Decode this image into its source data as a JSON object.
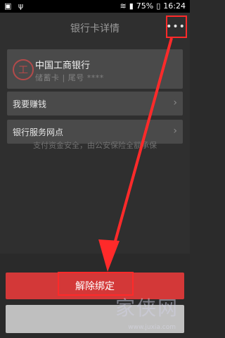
{
  "status": {
    "battery_pct": "75%",
    "time": "16:24"
  },
  "title_bar": {
    "title": "银行卡详情",
    "more": "•••"
  },
  "bank": {
    "name": "中国工商银行",
    "subtitle": "储蓄卡 | 尾号 ****"
  },
  "menu": [
    {
      "label": "我要赚钱"
    },
    {
      "label": "银行服务网点"
    }
  ],
  "security_note": "支付资金安全，由公安保险全额承保",
  "buttons": {
    "unbind": "解除绑定",
    "secondary": ""
  },
  "watermark": {
    "cn": "家侠网",
    "url": "www.juxia.com"
  },
  "colors": {
    "accent": "#d33838",
    "annotation": "#ff2a2a"
  },
  "icons": [
    "image-icon",
    "usb-icon",
    "wifi-icon",
    "signal-icon",
    "battery-icon",
    "more-icon",
    "icbc-logo-icon",
    "chevron-right-icon"
  ]
}
